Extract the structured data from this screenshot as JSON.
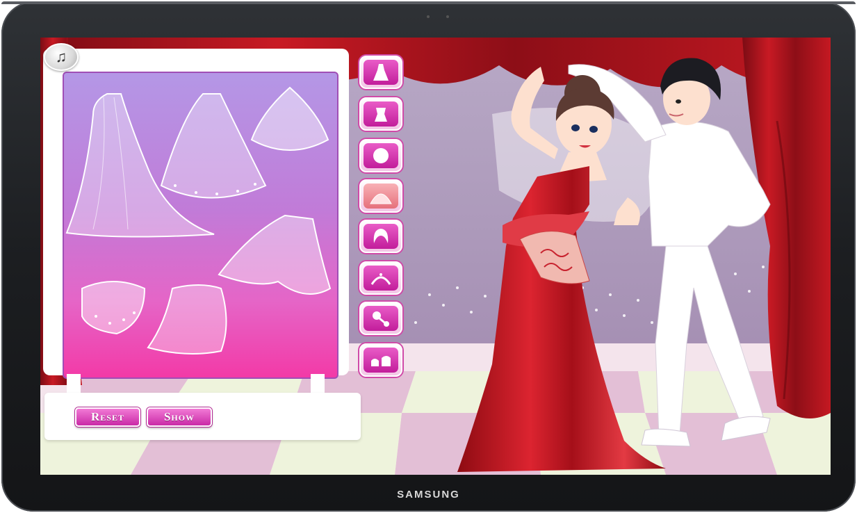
{
  "device": {
    "brand": "SAMSUNG"
  },
  "game": {
    "music_button": {
      "icon": "music-note-icon",
      "glyph": "♫"
    },
    "categories": [
      {
        "id": "dresses",
        "icon": "dress-icon"
      },
      {
        "id": "tops",
        "icon": "corset-top-icon"
      },
      {
        "id": "hair-short",
        "icon": "hair-bun-icon"
      },
      {
        "id": "veils",
        "icon": "veil-icon"
      },
      {
        "id": "hairstyles",
        "icon": "hairstyle-icon"
      },
      {
        "id": "tiaras",
        "icon": "tiara-icon"
      },
      {
        "id": "bouquets",
        "icon": "bouquet-icon"
      },
      {
        "id": "shoes",
        "icon": "shoes-icon"
      }
    ],
    "veil_items": [
      {
        "id": "veil-1",
        "icon": "long-veil-icon"
      },
      {
        "id": "veil-2",
        "icon": "cathedral-veil-icon"
      },
      {
        "id": "veil-3",
        "icon": "short-tulle-veil-icon"
      },
      {
        "id": "veil-4",
        "icon": "flowing-veil-icon"
      },
      {
        "id": "veil-5",
        "icon": "dotted-short-veil-icon"
      },
      {
        "id": "veil-6",
        "icon": "layered-veil-icon"
      }
    ],
    "buttons": {
      "reset": "Reset",
      "show": "Show"
    },
    "colors": {
      "accent": "#d04aa8",
      "curtain": "#b3141f",
      "gown": "#c8151f",
      "suit": "#ffffff"
    }
  }
}
